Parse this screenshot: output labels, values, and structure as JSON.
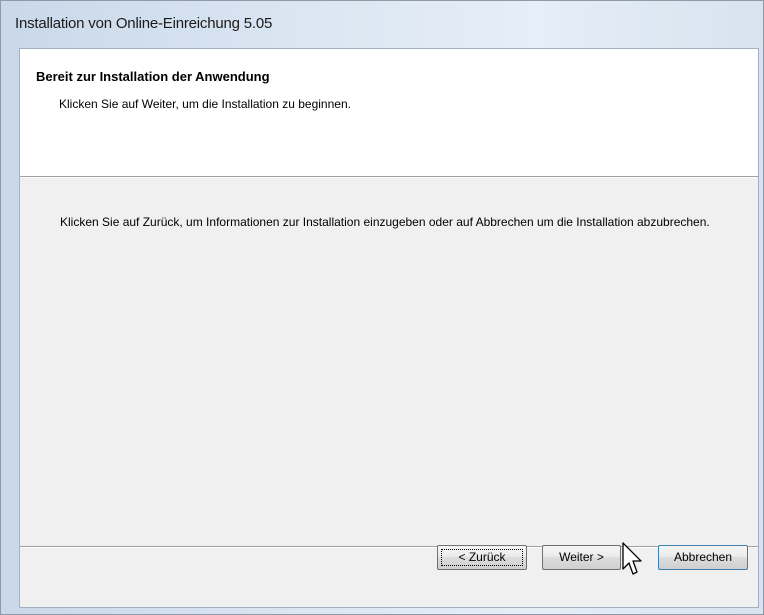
{
  "window": {
    "title": "Installation von Online-Einreichung 5.05"
  },
  "header": {
    "title": "Bereit zur Installation der Anwendung",
    "subtitle": "Klicken Sie auf Weiter, um die Installation zu beginnen."
  },
  "body": {
    "text": "Klicken Sie auf Zurück, um Informationen zur Installation einzugeben oder auf Abbrechen um die Installation abzubrechen."
  },
  "buttons": {
    "back_label": "< Zurück",
    "next_label": "Weiter >",
    "cancel_label": "Abbrechen"
  },
  "cursor": {
    "icon": "arrow-cursor-icon"
  }
}
